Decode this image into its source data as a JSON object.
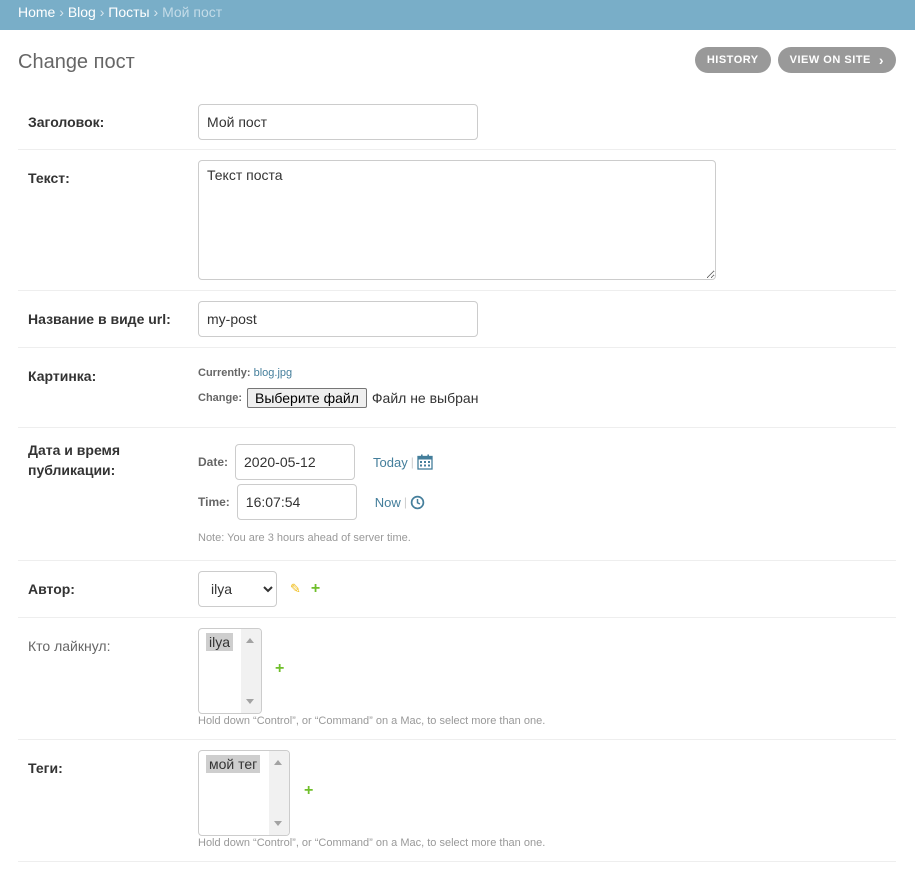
{
  "breadcrumbs": {
    "home": "Home",
    "app": "Blog",
    "model": "Посты",
    "current": "Мой пост",
    "sep": "›"
  },
  "page": {
    "title": "Change пост",
    "history_label": "HISTORY",
    "view_on_site_label": "VIEW ON SITE",
    "view_on_site_chevron": "›"
  },
  "fields": {
    "title": {
      "label": "Заголовок:",
      "value": "Мой пост"
    },
    "text": {
      "label": "Текст:",
      "value": "Текст поста"
    },
    "slug": {
      "label": "Название в виде url:",
      "value": "my-post"
    },
    "image": {
      "label": "Картинка:",
      "currently_label": "Currently:",
      "current_file": "blog.jpg",
      "change_label": "Change:",
      "choose_button": "Выберите файл",
      "no_file": "Файл не выбран"
    },
    "published": {
      "label_line1": "Дата и время",
      "label_line2": "публикации:",
      "date_label": "Date:",
      "date_value": "2020-05-12",
      "today_link": "Today",
      "time_label": "Time:",
      "time_value": "16:07:54",
      "now_link": "Now",
      "pipe": "|",
      "note": "Note: You are 3 hours ahead of server time."
    },
    "author": {
      "label": "Автор:",
      "selected": "ilya"
    },
    "likes": {
      "label": "Кто лайкнул:",
      "selected_option": "ilya",
      "help": "Hold down “Control”, or “Command” on a Mac, to select more than one."
    },
    "tags": {
      "label": "Теги:",
      "selected_option": "мой тег",
      "help": "Hold down “Control”, or “Command” on a Mac, to select more than one."
    }
  },
  "icons": {
    "add": "+",
    "edit": "✎",
    "calendar": "calendar-icon",
    "clock": "clock-icon"
  },
  "colors": {
    "header_bg": "#79aec8",
    "link": "#447e9b",
    "add_green": "#70bf2b",
    "edit_yellow": "#efb80b",
    "tool_btn_bg": "#999999"
  }
}
